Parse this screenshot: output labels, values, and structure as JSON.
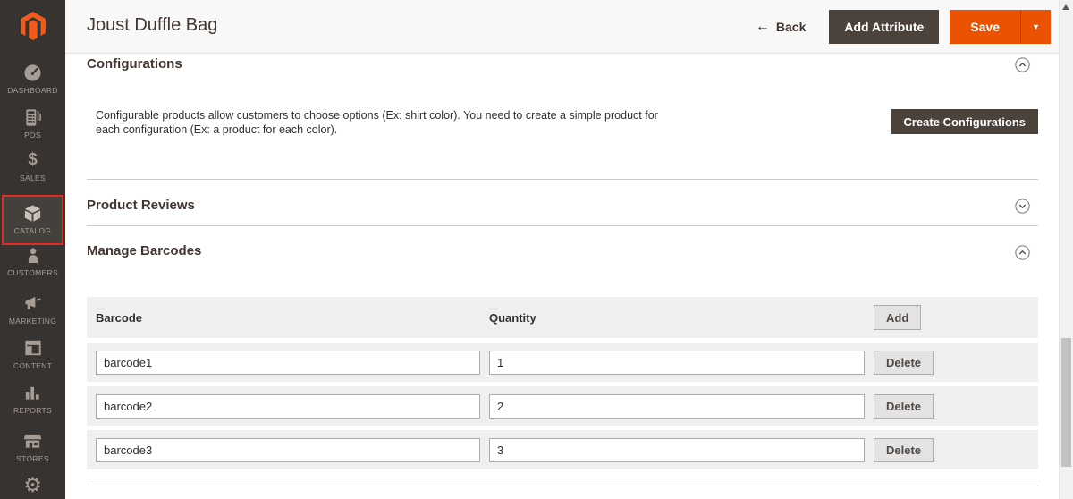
{
  "window": {
    "title": "Joust Duffle Bag"
  },
  "header": {
    "title": "Joust Duffle Bag",
    "back_arrow": "←",
    "back_label": "Back",
    "add_attribute_label": "Add Attribute",
    "save_label": "Save",
    "save_caret": "▼"
  },
  "sidebar": {
    "items": [
      {
        "label": "DASHBOARD",
        "icon": "dashboard-gauge-icon",
        "selected": false
      },
      {
        "label": "POS",
        "icon": "pos-terminal-icon",
        "selected": false
      },
      {
        "label": "SALES",
        "icon": "dollar-icon",
        "selected": false
      },
      {
        "label": "CATALOG",
        "icon": "box-icon",
        "selected": true
      },
      {
        "label": "CUSTOMERS",
        "icon": "person-icon",
        "selected": false
      },
      {
        "label": "MARKETING",
        "icon": "megaphone-icon",
        "selected": false
      },
      {
        "label": "CONTENT",
        "icon": "layout-icon",
        "selected": false
      },
      {
        "label": "REPORTS",
        "icon": "bar-chart-icon",
        "selected": false
      },
      {
        "label": "STORES",
        "icon": "storefront-icon",
        "selected": false
      },
      {
        "label": "",
        "icon": "gear-icon",
        "selected": false
      }
    ],
    "dollar_glyph": "$",
    "gear_glyph": "⚙"
  },
  "sections": {
    "configurations": {
      "title": "Configurations",
      "collapse_state": "expanded",
      "description": "Configurable products allow customers to choose options (Ex: shirt color). You need to create a simple product for each configuration (Ex: a product for each color).",
      "create_button_label": "Create Configurations"
    },
    "product_reviews": {
      "title": "Product Reviews",
      "collapse_state": "collapsed"
    },
    "manage_barcodes": {
      "title": "Manage Barcodes",
      "collapse_state": "expanded",
      "table": {
        "columns": [
          "Barcode",
          "Quantity"
        ],
        "add_button_label": "Add",
        "delete_button_label": "Delete",
        "rows": [
          {
            "barcode": "barcode1",
            "quantity": "1"
          },
          {
            "barcode": "barcode2",
            "quantity": "2"
          },
          {
            "barcode": "barcode3",
            "quantity": "3"
          }
        ]
      }
    }
  },
  "colors": {
    "accent_orange": "#eb5202",
    "sidebar_bg": "#373330",
    "selected_border_red": "#e02b27",
    "dark_button_bg": "#4a423b",
    "secondary_button_bg": "#e3e3e3",
    "table_row_bg": "#efefef",
    "header_bg": "#f8f8f8",
    "heading_text": "#41362f"
  }
}
